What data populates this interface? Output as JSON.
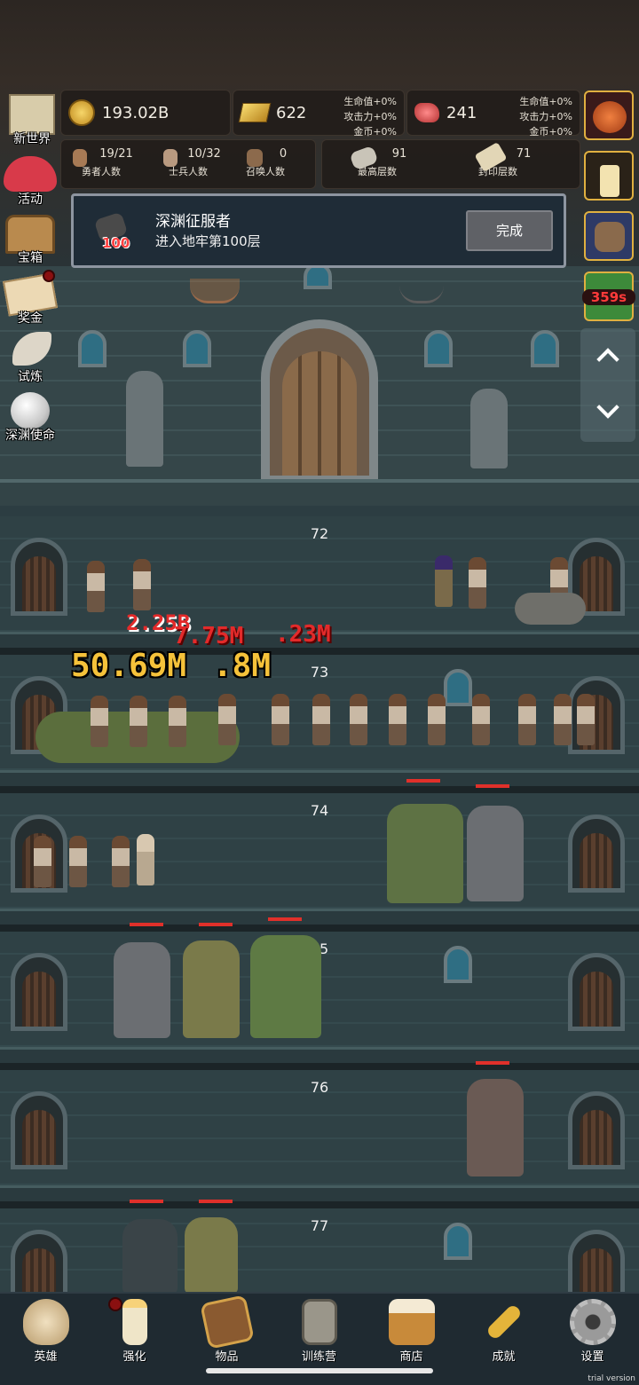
{
  "resources": {
    "gold": "193.02B",
    "gold_bar": "622",
    "gold_bar_bonus": [
      "生命值+0%",
      "攻击力+0%",
      "金币+0%"
    ],
    "meat": "241",
    "meat_bonus": [
      "生命值+0%",
      "攻击力+0%",
      "金币+0%"
    ]
  },
  "stats": {
    "heroes": {
      "value": "19/21",
      "label": "勇者人数"
    },
    "soldiers": {
      "value": "10/32",
      "label": "士兵人数"
    },
    "summons": {
      "value": "0",
      "label": "召唤人数"
    },
    "highest_floor": {
      "value": "91",
      "label": "最高层数"
    },
    "sealed_floor": {
      "value": "71",
      "label": "封印层数"
    }
  },
  "quest": {
    "title": "深渊征服者",
    "description": "进入地牢第100层",
    "icon_number": "100",
    "button": "完成"
  },
  "left_menu": [
    {
      "label": "新世界",
      "icon": "map-icon"
    },
    {
      "label": "活动",
      "icon": "heart-icon"
    },
    {
      "label": "宝箱",
      "icon": "chest-icon"
    },
    {
      "label": "奖金",
      "icon": "envelope-icon"
    },
    {
      "label": "试炼",
      "icon": "feather-icon"
    },
    {
      "label": "深渊使命",
      "icon": "pearl-icon"
    }
  ],
  "right_menu": {
    "timer": "359s",
    "scroll_up": "⌃",
    "scroll_down": "⌄"
  },
  "floors": [
    "72",
    "73",
    "74",
    "75",
    "76",
    "77"
  ],
  "damage_texts": {
    "red_1": "2.25B",
    "red_2": "7.75M",
    "red_3": ".23M",
    "yellow": "50.69M",
    "yellow_tail": ".8M"
  },
  "nav": [
    {
      "label": "英雄",
      "icon": "skull-icon"
    },
    {
      "label": "强化",
      "icon": "candle-icon"
    },
    {
      "label": "物品",
      "icon": "book-icon"
    },
    {
      "label": "训练营",
      "icon": "lantern-icon"
    },
    {
      "label": "商店",
      "icon": "beer-icon"
    },
    {
      "label": "成就",
      "icon": "key-icon"
    },
    {
      "label": "设置",
      "icon": "gear-icon"
    }
  ],
  "watermark": "trial version",
  "colors": {
    "hp_bar": "#e0302a",
    "damage_red": "#e32a2a",
    "damage_yellow": "#f5c23a"
  }
}
